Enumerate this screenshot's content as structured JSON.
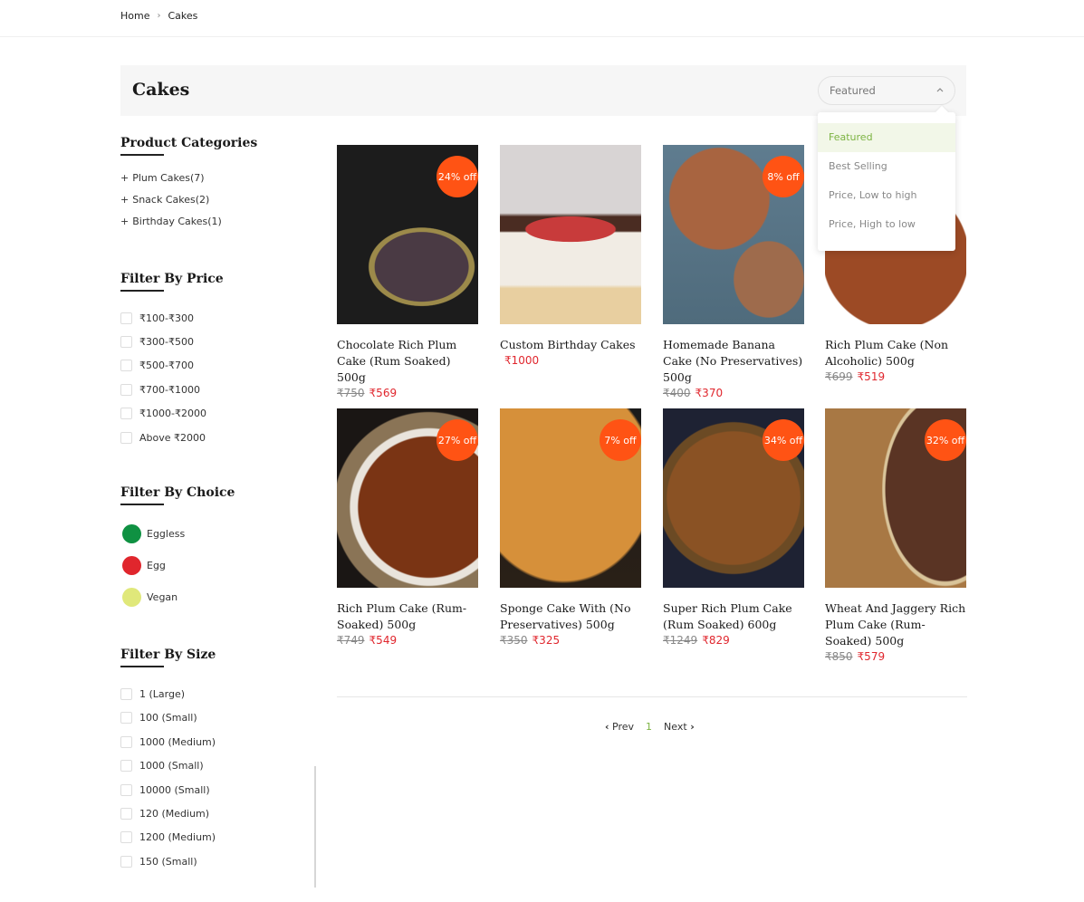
{
  "breadcrumb": {
    "items": [
      "Home",
      "Cakes"
    ],
    "separator": "›"
  },
  "page_title": "Cakes",
  "sort": {
    "selected": "Featured",
    "chevron_icon": "chevron-up-icon",
    "options": [
      "Featured",
      "Best Selling",
      "Price, Low to high",
      "Price, High to low"
    ],
    "active_color": "#7cb342"
  },
  "sidebar": {
    "categories": {
      "title": "Product Categories",
      "items": [
        {
          "label": "Plum Cakes(7)"
        },
        {
          "label": "Snack Cakes(2)"
        },
        {
          "label": "Birthday Cakes(1)"
        }
      ]
    },
    "price": {
      "title": "Filter By Price",
      "items": [
        "₹100-₹300",
        "₹300-₹500",
        "₹500-₹700",
        "₹700-₹1000",
        "₹1000-₹2000",
        "Above ₹2000"
      ]
    },
    "choice": {
      "title": "Filter By Choice",
      "items": [
        {
          "label": "Eggless",
          "color": "#0f9142"
        },
        {
          "label": "Egg",
          "color": "#e0262d"
        },
        {
          "label": "Vegan",
          "color": "#e0e87a"
        }
      ]
    },
    "size": {
      "title": "Filter By Size",
      "items": [
        "1 (Large)",
        "100 (Small)",
        "1000 (Medium)",
        "1000 (Small)",
        "10000 (Small)",
        "120 (Medium)",
        "1200 (Medium)",
        "150 (Small)"
      ]
    }
  },
  "products": [
    {
      "name": "Chocolate Rich Plum Cake (Rum Soaked) 500g",
      "old_price": "₹750",
      "price": "₹569",
      "badge": "24% off",
      "image": "chocolate-plum-cake-in-tin"
    },
    {
      "name": "Custom Birthday Cakes",
      "old_price": "",
      "price": "₹1000",
      "badge": "",
      "image": "naked-cake-with-berries"
    },
    {
      "name": "Homemade Banana Cake (No Preservatives) 500g",
      "old_price": "₹400",
      "price": "₹370",
      "badge": "8% off",
      "image": "banana-cake-sliced"
    },
    {
      "name": "Rich Plum Cake (Non Alcoholic) 500g",
      "old_price": "₹699",
      "price": "₹519",
      "badge": "",
      "image": "plum-cake-with-cashews"
    },
    {
      "name": "Rich Plum Cake (Rum-Soaked) 500g",
      "old_price": "₹749",
      "price": "₹549",
      "badge": "27% off",
      "image": "plum-cake-on-jute"
    },
    {
      "name": "Sponge Cake With (No Preservatives) 500g",
      "old_price": "₹350",
      "price": "₹325",
      "badge": "7% off",
      "image": "sponge-cake"
    },
    {
      "name": "Super Rich Plum Cake (Rum Soaked) 600g",
      "old_price": "₹1249",
      "price": "₹829",
      "badge": "34% off",
      "image": "nut-plum-cake-in-basket"
    },
    {
      "name": "Wheat And Jaggery Rich Plum Cake (Rum-Soaked) 500g",
      "old_price": "₹850",
      "price": "₹579",
      "badge": "32% off",
      "image": "jaggery-cake-in-tin"
    }
  ],
  "pagination": {
    "prev": "Prev",
    "current": "1",
    "next": "Next"
  },
  "colors": {
    "badge": "#ff5314",
    "sale_price": "#e0262d",
    "accent": "#7cb342"
  }
}
